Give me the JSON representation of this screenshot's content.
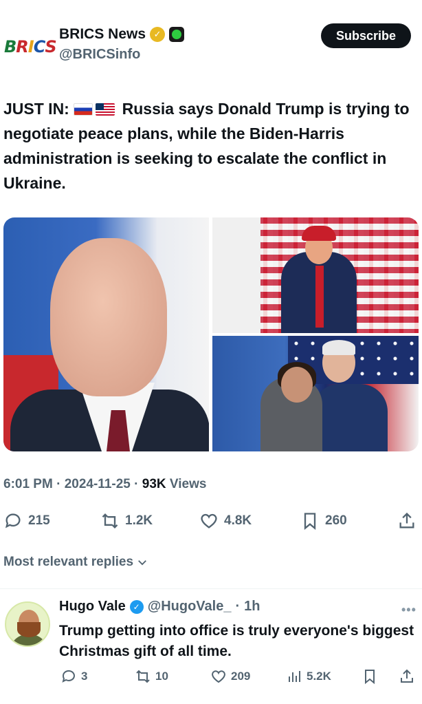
{
  "post": {
    "author_name": "BRICS News",
    "author_handle": "@BRICSinfo",
    "logo_text": "BRICS",
    "subscribe_label": "Subscribe",
    "text_prefix": "JUST IN:",
    "text_body": "Russia says Donald Trump is trying to negotiate peace plans, while the Biden-Harris administration is seeking to escalate the conflict in Ukraine.",
    "time": "6:01 PM",
    "date": "2024-11-25",
    "views_count": "93K",
    "views_label": "Views",
    "stats": {
      "replies": "215",
      "reposts": "1.2K",
      "likes": "4.8K",
      "bookmarks": "260"
    },
    "relevance_label": "Most relevant replies"
  },
  "reply": {
    "name": "Hugo Vale",
    "handle": "@HugoVale_",
    "time": "1h",
    "text": "Trump getting into office is truly everyone's biggest Christmas gift of all time.",
    "stats": {
      "replies": "3",
      "reposts": "10",
      "likes": "209",
      "views": "5.2K"
    }
  },
  "colors": {
    "subscribe_bg": "#0f1419",
    "muted_text": "#536471",
    "verified_blue": "#1d9bf0",
    "gold_badge": "#e8b923"
  },
  "icons": [
    "reply-icon",
    "repost-icon",
    "like-icon",
    "bookmark-icon",
    "share-icon",
    "views-icon",
    "more-icon",
    "chevron-down-icon"
  ]
}
